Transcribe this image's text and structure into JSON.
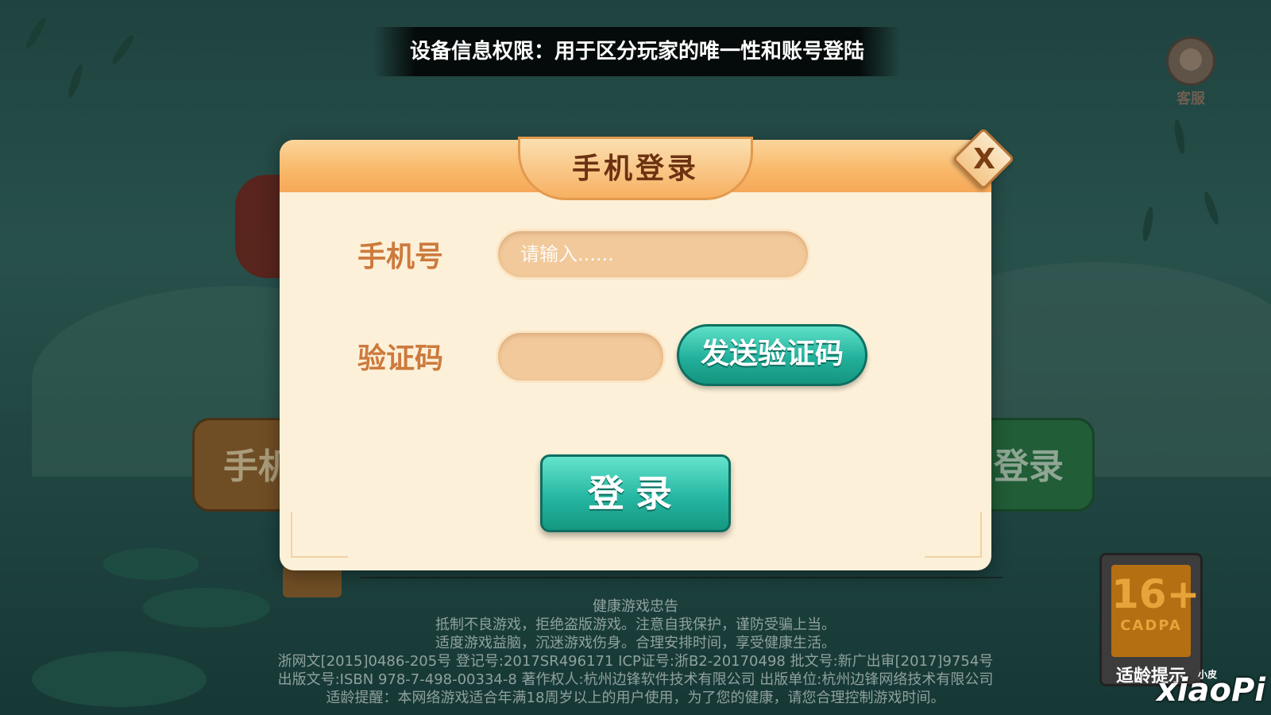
{
  "notice": {
    "text": "设备信息权限：用于区分玩家的唯一性和账号登陆"
  },
  "customer_service": {
    "label": "客服"
  },
  "background": {
    "left_button_label": "手机",
    "right_button_label": "登录"
  },
  "dialog": {
    "title": "手机登录",
    "close_label": "X",
    "phone": {
      "label": "手机号",
      "placeholder": "请输入......",
      "value": ""
    },
    "code": {
      "label": "验证码",
      "value": ""
    },
    "send_code_label": "发送验证码",
    "login_label": "登录"
  },
  "footer": {
    "lines": [
      "健康游戏忠告",
      "抵制不良游戏，拒绝盗版游戏。注意自我保护，谨防受骗上当。",
      "适度游戏益脑，沉迷游戏伤身。合理安排时间，享受健康生活。",
      "浙网文[2015]0486-205号  登记号:2017SR496171  ICP证号:浙B2-20170498  批文号:新广出审[2017]9754号",
      "出版文号:ISBN 978-7-498-00334-8  著作权人:杭州边锋软件技术有限公司  出版单位:杭州边锋网络技术有限公司",
      "适龄提醒：本网络游戏适合年满18周岁以上的用户使用，为了您的健康，请您合理控制游戏时间。"
    ]
  },
  "age_rating": {
    "value": "16+",
    "org": "CADPA",
    "caption": "适龄提示"
  },
  "watermark": {
    "small": "小皮",
    "text": "xiaoPi"
  }
}
